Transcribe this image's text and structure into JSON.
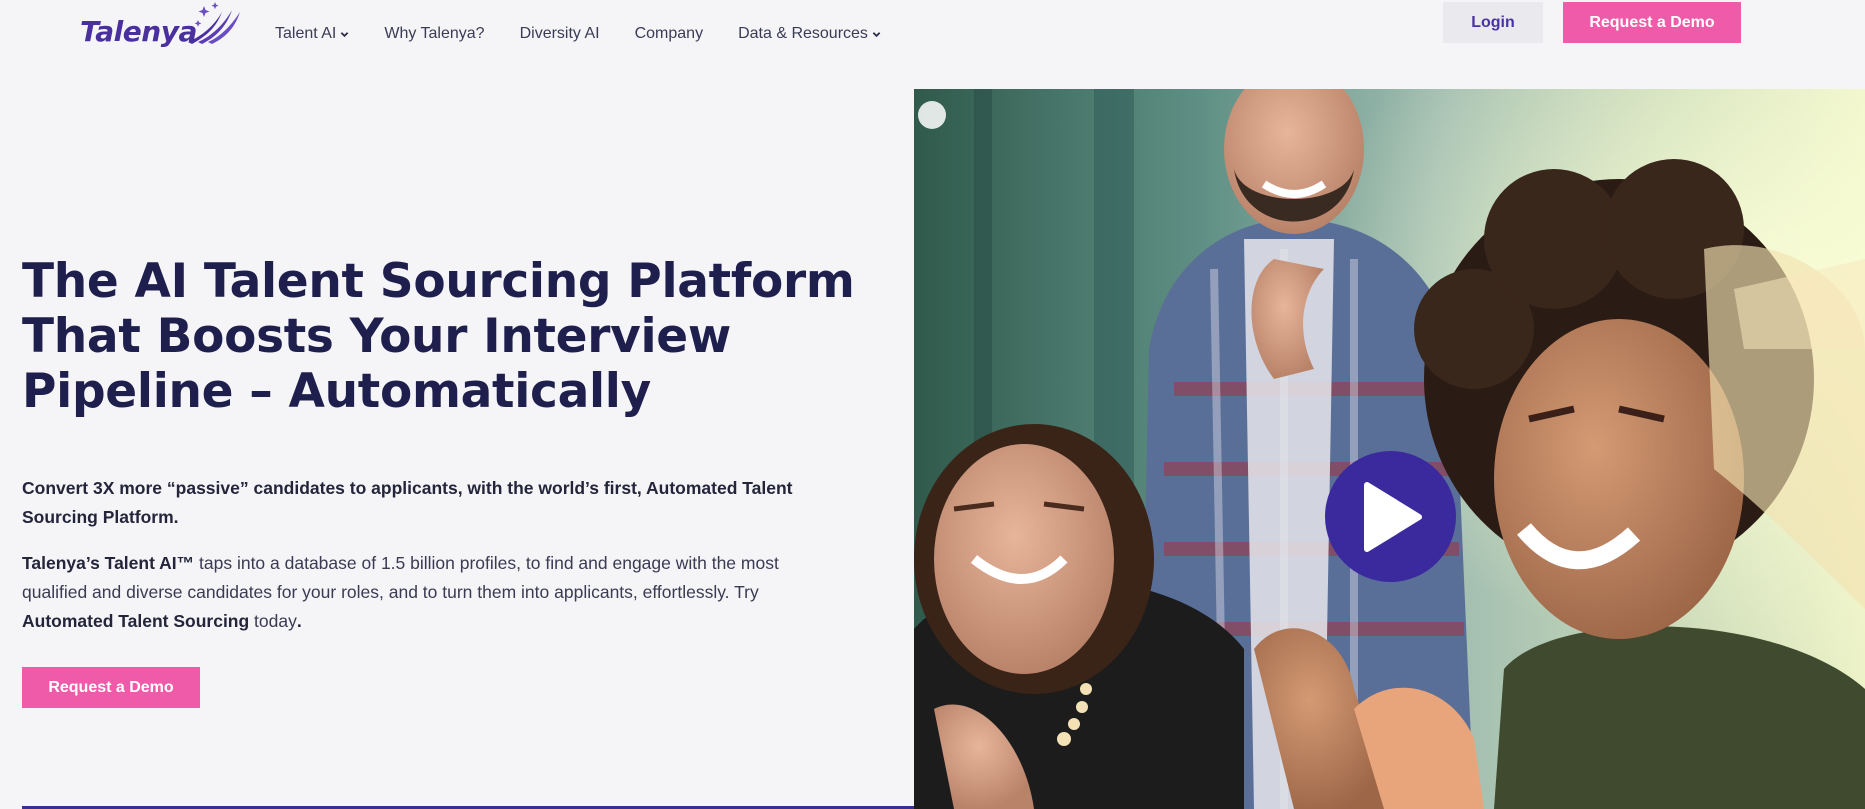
{
  "brand": {
    "name": "Talenya",
    "colors": {
      "primary": "#4a2f9f",
      "accent": "#ef5ba9",
      "heading": "#1e1f4d"
    }
  },
  "nav": {
    "items": [
      {
        "label": "Talent AI",
        "has_dropdown": true
      },
      {
        "label": "Why Talenya?",
        "has_dropdown": false
      },
      {
        "label": "Diversity AI",
        "has_dropdown": false
      },
      {
        "label": "Company",
        "has_dropdown": false
      },
      {
        "label": "Data & Resources",
        "has_dropdown": true
      }
    ],
    "login_label": "Login",
    "demo_label": "Request a Demo"
  },
  "hero": {
    "title": "The AI Talent Sourcing Platform That Boosts Your Interview Pipeline – Automatically",
    "subtitle": "Convert 3X more “passive” candidates to applicants, with the world’s first, Automated Talent Sourcing Platform.",
    "body": {
      "part1_bold": "Talenya’s Talent AI™",
      "part2": " taps into a database of 1.5 billion profiles, to find and engage with the most qualified and diverse candidates for your roles, and to turn them into applicants, effortlessly. Try ",
      "part3_bold": "Automated Talent Sourcing",
      "part4": " today",
      "part5_bold": "."
    },
    "cta_label": "Request a Demo",
    "media": {
      "icon": "play-icon"
    }
  }
}
